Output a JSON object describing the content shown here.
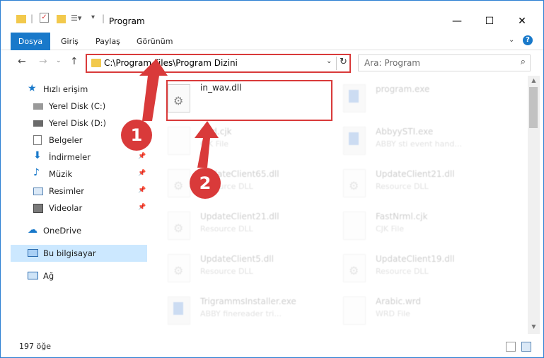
{
  "window": {
    "title": "Program"
  },
  "ribbon": {
    "tabs": [
      "Dosya",
      "Giriş",
      "Paylaş",
      "Görünüm"
    ],
    "help": "?"
  },
  "address": {
    "path": "C:\\Program Files\\Program Dizini"
  },
  "search": {
    "placeholder": "Ara: Program"
  },
  "nav": {
    "quick_access": "Hızlı erişim",
    "items": [
      "Yerel Disk (C:)",
      "Yerel Disk (D:)",
      "Belgeler",
      "İndirmeler",
      "Müzik",
      "Resimler",
      "Videolar"
    ],
    "onedrive": "OneDrive",
    "this_pc": "Bu bilgisayar",
    "network": "Ağ"
  },
  "files": [
    {
      "name": "in_wav.dll",
      "type": ""
    },
    {
      "name": "program.exe",
      "type": ""
    },
    {
      "name": "Bird.cjk",
      "type": "CJK File"
    },
    {
      "name": "AbbyySTI.exe",
      "type": "ABBY sti event hand..."
    },
    {
      "name": "UpdateClient65.dll",
      "type": "Resource DLL"
    },
    {
      "name": "UpdateClient21.dll",
      "type": "Resource DLL"
    },
    {
      "name": "UpdateClient21.dll",
      "type": "Resource DLL"
    },
    {
      "name": "FastNrml.cjk",
      "type": "CJK File"
    },
    {
      "name": "UpdateClient5.dll",
      "type": "Resource DLL"
    },
    {
      "name": "UpdateClient19.dll",
      "type": "Resource DLL"
    },
    {
      "name": "TrigrammsInstaller.exe",
      "type": "ABBY finereader tri..."
    },
    {
      "name": "Arabic.wrd",
      "type": "WRD File"
    }
  ],
  "status": {
    "count": "197 öğe"
  },
  "annotations": {
    "step1": "1",
    "step2": "2"
  },
  "colors": {
    "accent": "#1979ca",
    "highlight": "#d93a3a",
    "selection": "#cce8ff"
  }
}
